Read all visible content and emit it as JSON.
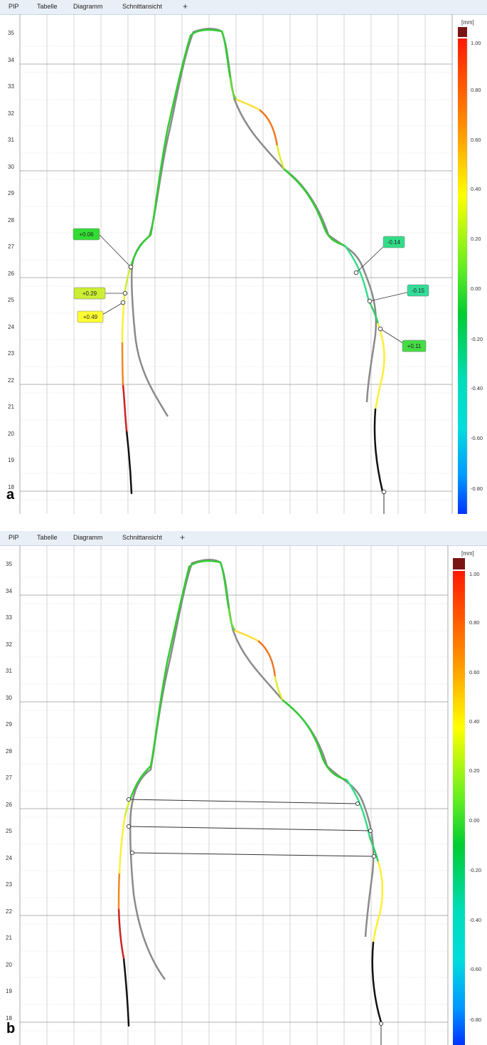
{
  "tabs": [
    "PIP",
    "Tabelle",
    "Diagramm",
    "Schnittansicht"
  ],
  "tab_add": "+",
  "panels": [
    {
      "label": "a",
      "y_ticks": [
        "35",
        "34",
        "33",
        "32",
        "31",
        "30",
        "29",
        "28",
        "27",
        "26",
        "25",
        "24",
        "23",
        "22",
        "21",
        "20",
        "19",
        "18"
      ],
      "deviation_labels": [
        "+0.06",
        "+0.29",
        "+0.49",
        "-0.14",
        "-0.15",
        "+0.11"
      ]
    },
    {
      "label": "b",
      "y_ticks": [
        "35",
        "34",
        "33",
        "32",
        "31",
        "30",
        "29",
        "28",
        "27",
        "26",
        "25",
        "24",
        "23",
        "22",
        "21",
        "20",
        "19",
        "18"
      ],
      "measure_line_count": 3
    }
  ],
  "colorbar": {
    "unit": "[mm]",
    "ticks": [
      "1.00",
      "0.80",
      "0.60",
      "0.40",
      "0.20",
      "0.00",
      "-0.20",
      "-0.40",
      "-0.60",
      "-0.80"
    ],
    "colors": [
      "#7a1414",
      "#ff1a00",
      "#ff8c00",
      "#ffff00",
      "#33cc33",
      "#00cc33",
      "#00dddd",
      "#00b7ff",
      "#0044ff"
    ]
  },
  "deviation_colors": {
    "+0.06": "#33dd33",
    "+0.29": "#ccee33",
    "+0.49": "#ffff33",
    "-0.14": "#33dd88",
    "-0.15": "#33dd99",
    "+0.11": "#44dd44"
  }
}
